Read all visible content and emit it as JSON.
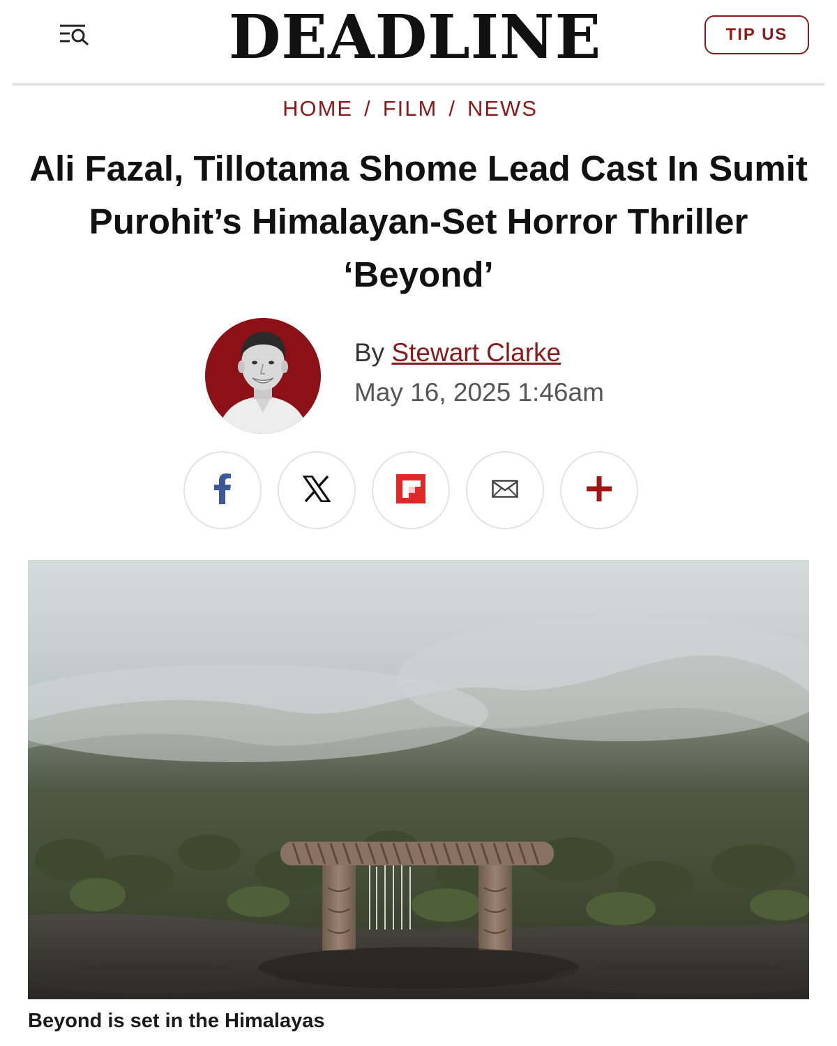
{
  "header": {
    "logo_text": "DEADLINE",
    "tip_label": "TIP US",
    "menu_icon": "menu-search-icon"
  },
  "breadcrumb": {
    "items": [
      "HOME",
      "FILM",
      "NEWS"
    ],
    "separator": "/"
  },
  "article": {
    "headline": "Ali Fazal, Tillotama Shome Lead Cast In Sumit Purohit’s Himalayan-Set Horror Thriller ‘Beyond’",
    "byline_prefix": "By",
    "author": "Stewart Clarke",
    "timestamp": "May 16, 2025 1:46am",
    "image_caption": "Beyond is set in the Himalayas"
  },
  "share": {
    "buttons": [
      "facebook-icon",
      "x-icon",
      "flipboard-icon",
      "email-icon",
      "plus-icon"
    ]
  },
  "colors": {
    "brand_red": "#8b1a1a",
    "text": "#111111",
    "border": "#e3e3e3"
  }
}
